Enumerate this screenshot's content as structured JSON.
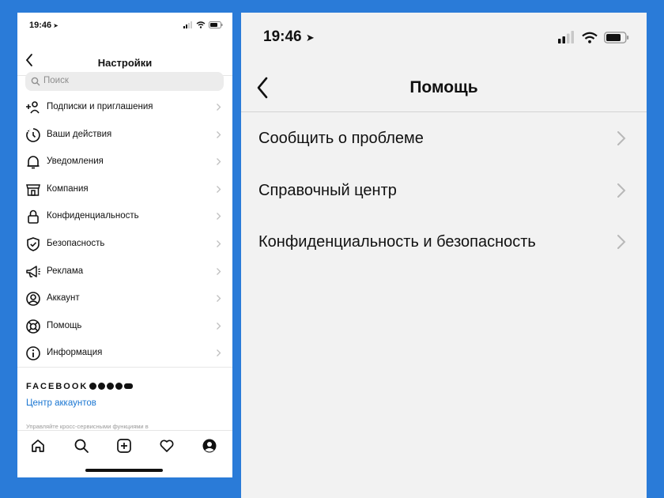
{
  "left": {
    "status": {
      "time": "19:46"
    },
    "header": {
      "title": "Настройки"
    },
    "search": {
      "placeholder": "Поиск"
    },
    "menu": [
      {
        "label": "Подписки и приглашения",
        "icon": "add-person-icon"
      },
      {
        "label": "Ваши действия",
        "icon": "activity-clock-icon"
      },
      {
        "label": "Уведомления",
        "icon": "bell-icon"
      },
      {
        "label": "Компания",
        "icon": "shop-icon"
      },
      {
        "label": "Конфиденциальность",
        "icon": "lock-icon"
      },
      {
        "label": "Безопасность",
        "icon": "shield-icon"
      },
      {
        "label": "Реклама",
        "icon": "megaphone-icon"
      },
      {
        "label": "Аккаунт",
        "icon": "account-circle-icon"
      },
      {
        "label": "Помощь",
        "icon": "lifebuoy-icon"
      },
      {
        "label": "Информация",
        "icon": "info-icon"
      }
    ],
    "facebook": {
      "brand": "FACEBOOK",
      "accounts_center": "Центр аккаунтов",
      "description": "Управляйте кросс-сервисными функциями в"
    },
    "tabbar": [
      "home-icon",
      "search-icon",
      "new-post-icon",
      "heart-icon",
      "profile-icon"
    ]
  },
  "right": {
    "status": {
      "time": "19:46"
    },
    "header": {
      "title": "Помощь"
    },
    "menu": [
      {
        "label": "Сообщить о проблеме"
      },
      {
        "label": "Справочный центр"
      },
      {
        "label": "Конфиденциальность и безопасность"
      }
    ]
  }
}
